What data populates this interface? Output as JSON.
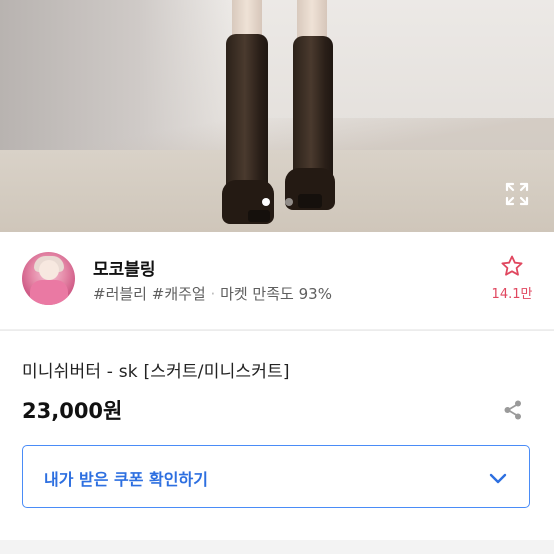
{
  "gallery": {
    "image_alt": "product photo",
    "dots": [
      {
        "active": true
      },
      {
        "active": false
      }
    ],
    "fullscreen_icon": "expand-icon"
  },
  "seller": {
    "name": "모코블링",
    "tags": [
      "#러블리",
      "#캐주얼"
    ],
    "satisfaction_label": "마켓 만족도",
    "satisfaction_value": "93%",
    "favorite_icon": "star-outline-icon",
    "favorite_count": "14.1만"
  },
  "product": {
    "title": "미니쉬버터 - sk [스커트/미니스커트]",
    "price": "23,000원",
    "share_icon": "share-icon"
  },
  "coupon": {
    "label": "내가 받은 쿠폰 확인하기",
    "chevron_icon": "chevron-down-icon"
  },
  "colors": {
    "accent_blue": "#2d6fe0",
    "favorite_pink": "#e0475f"
  }
}
